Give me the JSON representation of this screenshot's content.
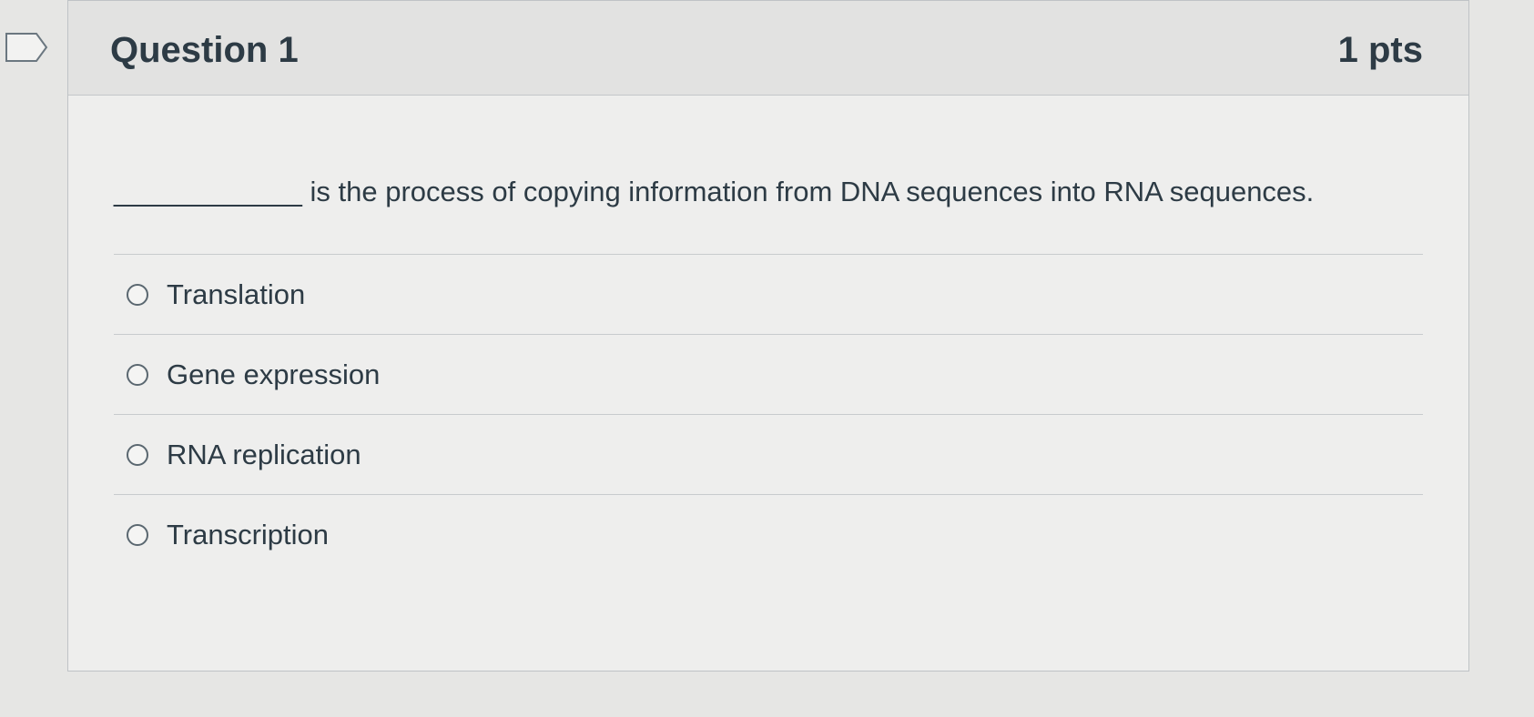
{
  "question": {
    "title": "Question 1",
    "points": "1 pts",
    "blank": "____________",
    "text": " is the process of copying information from DNA sequences into RNA sequences."
  },
  "answers": [
    {
      "label": "Translation",
      "selected": false
    },
    {
      "label": "Gene expression",
      "selected": false
    },
    {
      "label": "RNA replication",
      "selected": false
    },
    {
      "label": "Transcription",
      "selected": false
    }
  ],
  "icons": {
    "flag": "flag-outline-icon",
    "radio": "radio-unchecked-icon"
  }
}
